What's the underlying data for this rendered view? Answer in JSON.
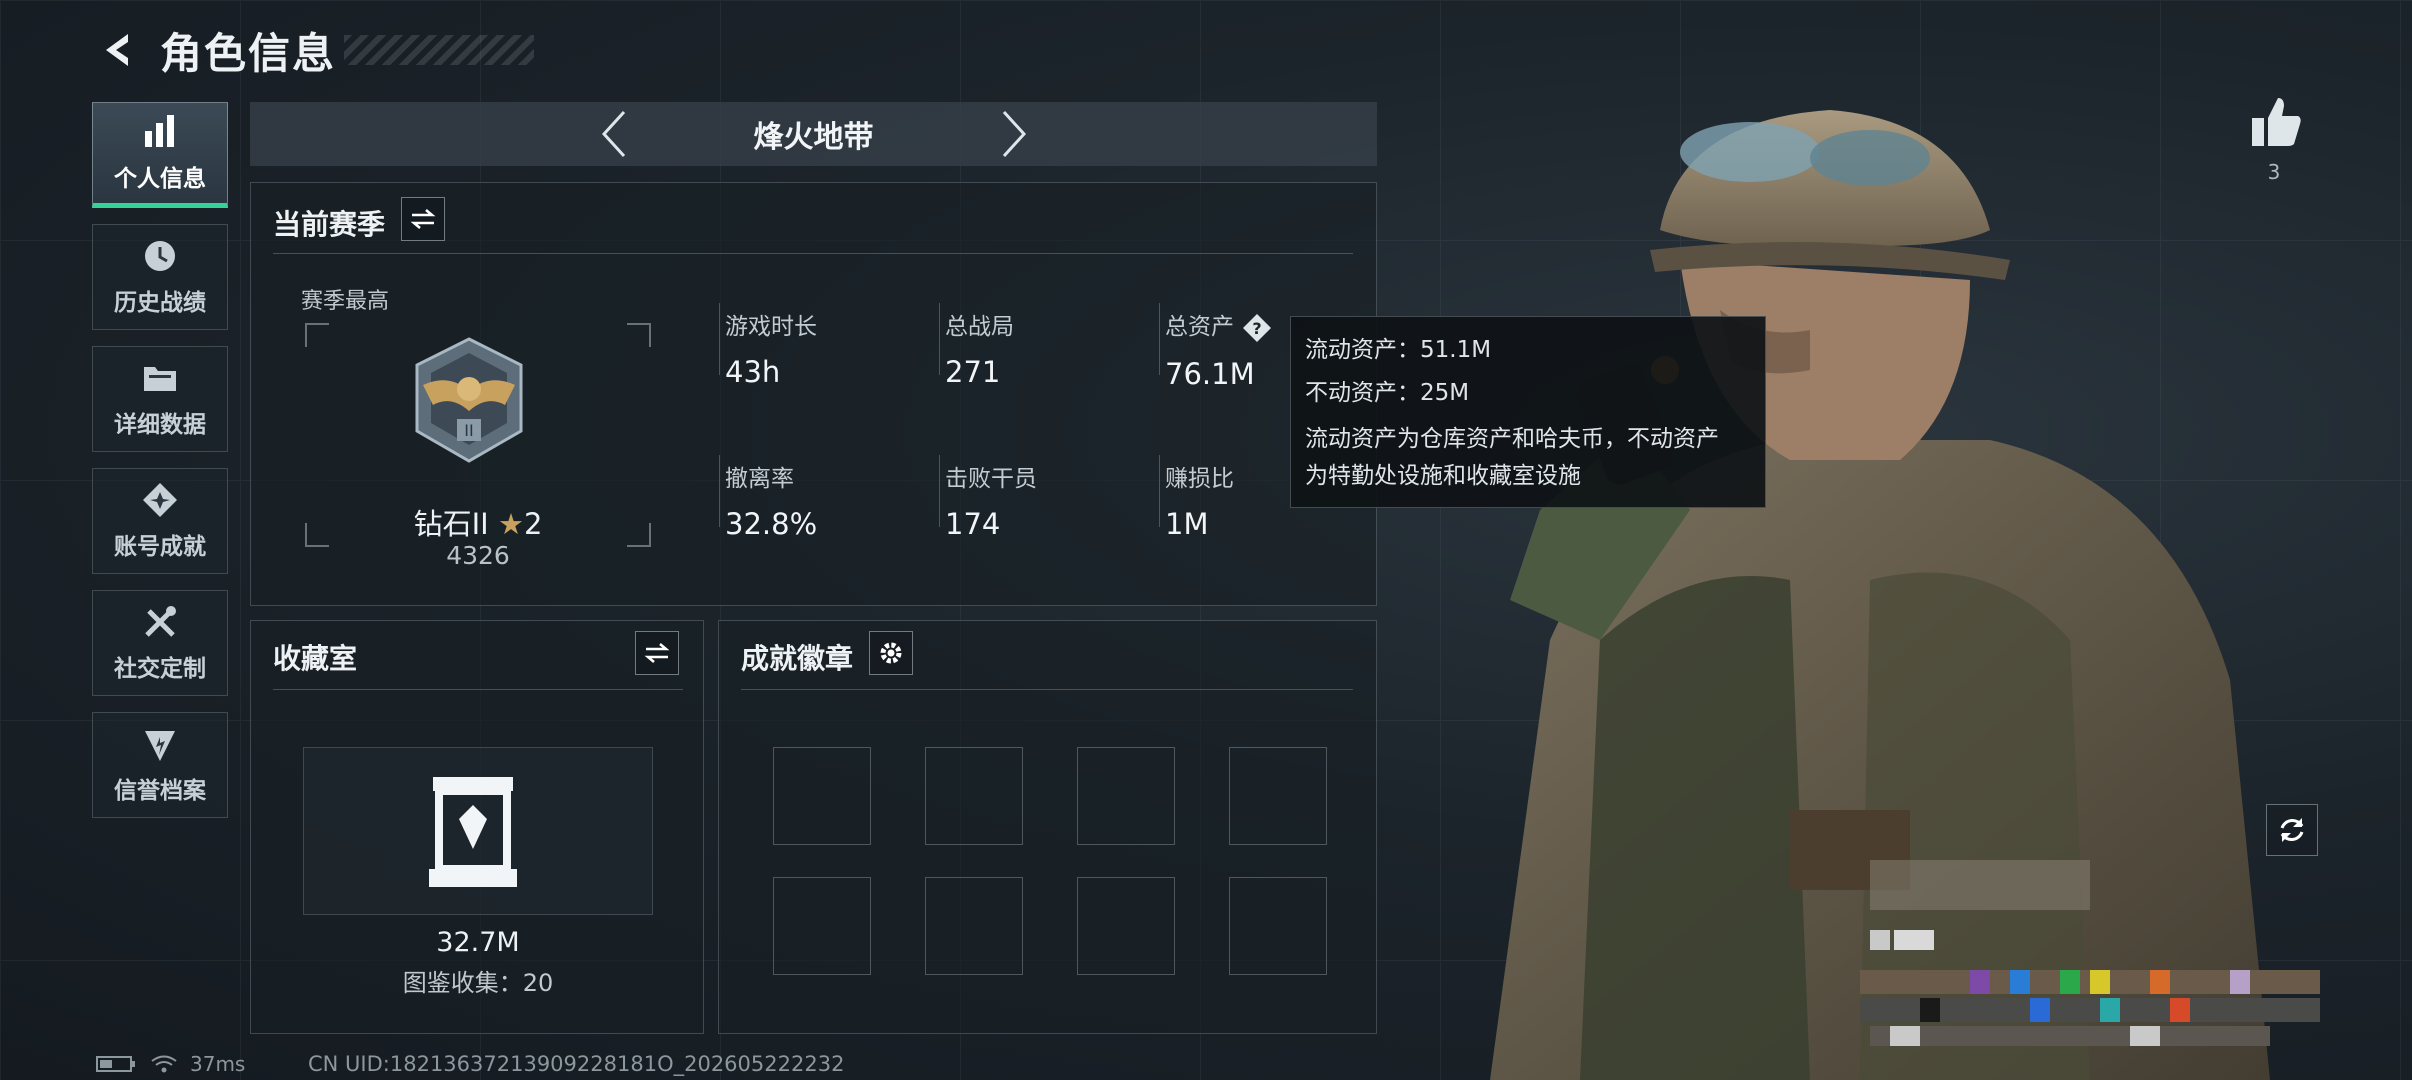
{
  "header": {
    "title": "角色信息"
  },
  "sidebar": {
    "items": [
      {
        "label": "个人信息",
        "active": true
      },
      {
        "label": "历史战绩"
      },
      {
        "label": "详细数据"
      },
      {
        "label": "账号成就"
      },
      {
        "label": "社交定制"
      },
      {
        "label": "信誉档案"
      }
    ]
  },
  "mode": {
    "title": "烽火地带"
  },
  "season": {
    "title": "当前赛季",
    "best_label": "赛季最高",
    "rank_name": "钻石II",
    "rank_stars": "2",
    "rank_score": "4326",
    "stats": [
      {
        "label": "游戏时长",
        "value": "43h"
      },
      {
        "label": "总战局",
        "value": "271"
      },
      {
        "label": "总资产",
        "value": "76.1M"
      },
      {
        "label": "撤离率",
        "value": "32.8%"
      },
      {
        "label": "击败干员",
        "value": "174"
      },
      {
        "label": "赚损比",
        "value": "1M"
      }
    ]
  },
  "tooltip": {
    "line1": "流动资产：51.1M",
    "line2": "不动资产：25M",
    "desc1": "流动资产为仓库资产和哈夫币，不动资产",
    "desc2": "为特勤处设施和收藏室设施"
  },
  "collection": {
    "title": "收藏室",
    "value": "32.7M",
    "count": "图鉴收集：20"
  },
  "achievements": {
    "title": "成就徽章"
  },
  "likes": {
    "count": "3"
  },
  "status": {
    "ping": "37ms",
    "uid": "CN UID:18213637213909228181O_202605222232"
  },
  "colors": {
    "accent_green": "#35d29a",
    "panel_bg": "#1c242b"
  },
  "icons": {
    "back": "chevron-left-icon",
    "like": "thumbs-up-icon",
    "refresh": "refresh-icon",
    "swap": "swap-icon",
    "settings": "gear-icon",
    "help": "question-icon"
  }
}
